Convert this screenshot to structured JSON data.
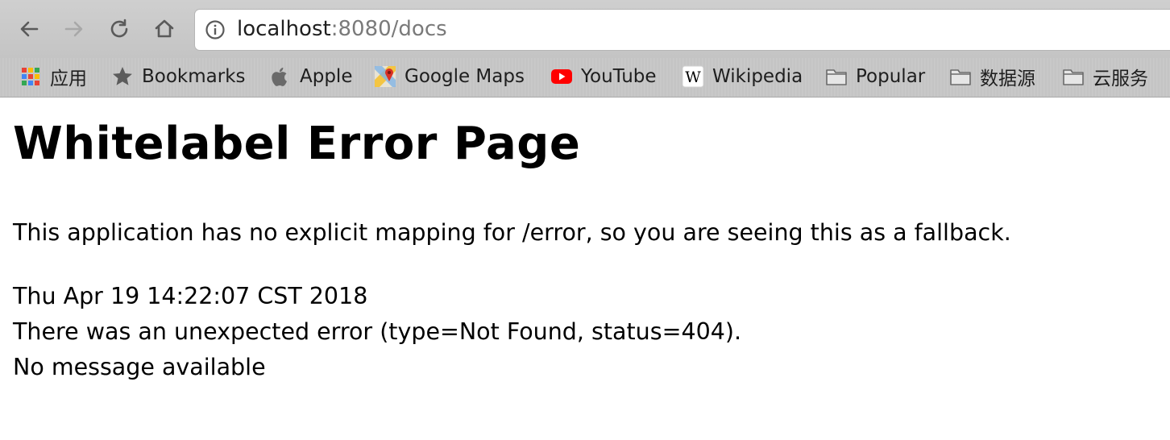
{
  "browser": {
    "address_bar": {
      "host": "localhost",
      "rest": ":8080/docs"
    },
    "bookmarks": [
      {
        "label": "应用",
        "icon": "apps-grid-icon"
      },
      {
        "label": "Bookmarks",
        "icon": "star-icon"
      },
      {
        "label": "Apple",
        "icon": "apple-icon"
      },
      {
        "label": "Google Maps",
        "icon": "google-maps-icon"
      },
      {
        "label": "YouTube",
        "icon": "youtube-icon"
      },
      {
        "label": "Wikipedia",
        "icon": "wikipedia-icon"
      },
      {
        "label": "Popular",
        "icon": "folder-icon"
      },
      {
        "label": "数据源",
        "icon": "folder-icon"
      },
      {
        "label": "云服务",
        "icon": "folder-icon"
      }
    ]
  },
  "page": {
    "title": "Whitelabel Error Page",
    "message": "This application has no explicit mapping for /error, so you are seeing this as a fallback.",
    "timestamp": "Thu Apr 19 14:22:07 CST 2018",
    "error_line": "There was an unexpected error (type=Not Found, status=404).",
    "detail": "No message available"
  },
  "colors": {
    "youtube_red": "#ff0000",
    "text": "#000000"
  }
}
